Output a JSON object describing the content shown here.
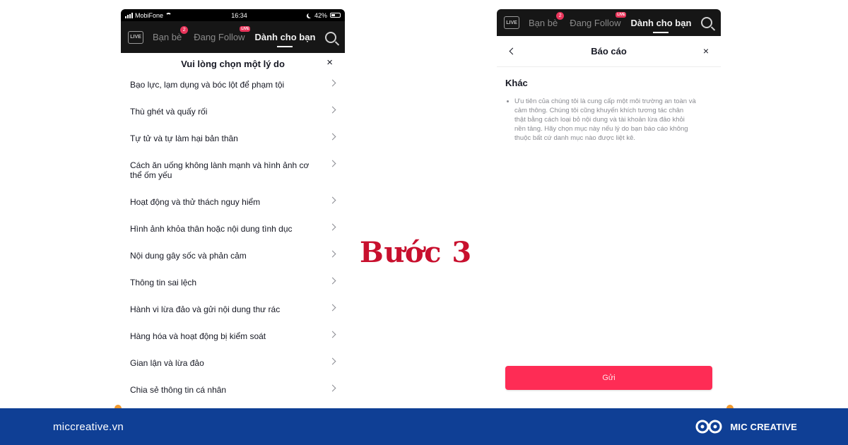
{
  "left_phone": {
    "status": {
      "carrier": "MobiFone",
      "time": "16:34",
      "battery": "42%"
    },
    "nav": {
      "live_label": "LIVE",
      "tabs": [
        {
          "label": "Bạn bè",
          "badge": "2"
        },
        {
          "label": "Đang Follow",
          "badge": "LIVE"
        },
        {
          "label": "Dành cho bạn"
        }
      ]
    },
    "sheet": {
      "title": "Vui lòng chọn một lý do",
      "close": "×",
      "reasons": [
        "Bạo lực, lạm dụng và bóc lột để phạm tội",
        "Thù ghét và quấy rối",
        "Tự tử và tự làm hại bản thân",
        "Cách ăn uống không lành mạnh và hình ảnh cơ thể ốm yếu",
        "Hoạt động và thử thách nguy hiểm",
        "Hình ảnh khỏa thân hoặc nội dung tình dục",
        "Nội dung gây sốc và phản cảm",
        "Thông tin sai lệch",
        "Hành vi lừa đảo và gửi nội dung thư rác",
        "Hàng hóa và hoạt động bị kiểm soát",
        "Gian lận và lừa đảo",
        "Chia sẻ thông tin cá nhân"
      ]
    }
  },
  "right_phone": {
    "nav": {
      "live_label": "LIVE",
      "tabs": [
        {
          "label": "Bạn bè",
          "badge": "2"
        },
        {
          "label": "Đang Follow",
          "badge": "LIVE"
        },
        {
          "label": "Dành cho bạn"
        }
      ]
    },
    "report": {
      "title": "Báo cáo",
      "close": "×",
      "section_title": "Khác",
      "description": "Ưu tiên của chúng tôi là cung cấp một môi trường an toàn và cảm thông. Chúng tôi cũng khuyến khích tương tác chân thật bằng cách loại bỏ nội dung và tài khoản lừa đảo khỏi nền tảng. Hãy chọn mục này nếu lý do bạn báo cáo không thuộc bất cứ danh mục nào được liệt kê.",
      "submit_label": "Gửi"
    }
  },
  "step_label": "Bước 3",
  "footer": {
    "url": "miccreative.vn",
    "brand_name": "MIC CREATIVE"
  },
  "colors": {
    "accent_red": "#fe2c55",
    "step_red": "#c8102e",
    "footer_blue": "#0f3f95",
    "footer_accent": "#f29a2e"
  }
}
